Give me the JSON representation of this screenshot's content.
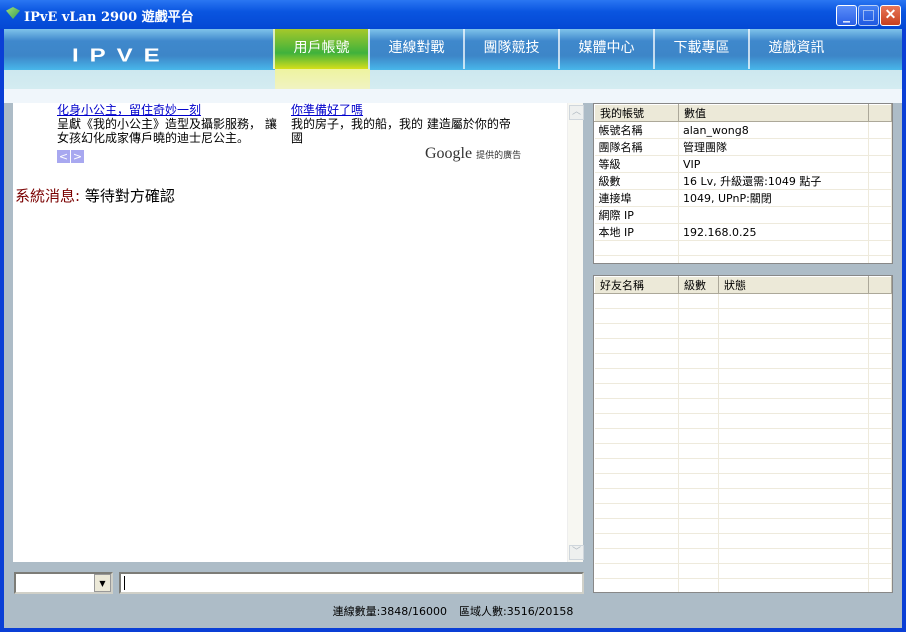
{
  "window": {
    "title": "IPvE vLan 2900 遊戲平台"
  },
  "nav": {
    "logo": "IPVE",
    "tabs": [
      {
        "label": "用戶帳號",
        "active": true
      },
      {
        "label": "連線對戰"
      },
      {
        "label": "團隊競技"
      },
      {
        "label": "媒體中心"
      },
      {
        "label": "下載專區"
      },
      {
        "label": "遊戲資訊"
      }
    ]
  },
  "ads": [
    {
      "title": "化身小公主，留住奇妙一刻",
      "body": "呈獻《我的小公主》造型及攝影服務， 讓女孩幻化成家傳戶曉的迪士尼公主。"
    },
    {
      "title": "你準備好了嗎",
      "body": "我的房子，我的船，我的 建造屬於你的帝國"
    }
  ],
  "ad_nav": {
    "prev": "<",
    "next": ">"
  },
  "google": {
    "brand": "Google",
    "label": "提供的廣告"
  },
  "system": {
    "label": "系統消息:",
    "message": "等待對方確認"
  },
  "account_table": {
    "headers": [
      "我的帳號",
      "數值"
    ],
    "rows": [
      [
        "帳號名稱",
        "alan_wong8"
      ],
      [
        "團隊名稱",
        "管理團隊"
      ],
      [
        "等級",
        "VIP"
      ],
      [
        "級數",
        "16 Lv, 升級還需:1049 點子"
      ],
      [
        "連接埠",
        "1049, UPnP:關閉"
      ],
      [
        "網際 IP",
        ""
      ],
      [
        "本地 IP",
        "192.168.0.25"
      ]
    ]
  },
  "friends_table": {
    "headers": [
      "好友名稱",
      "級數",
      "狀態"
    ],
    "rows": []
  },
  "chat": {
    "select_value": "",
    "input_value": ""
  },
  "status": {
    "connections": "連線數量:3848/16000",
    "region": "區域人數:3516/20158"
  }
}
